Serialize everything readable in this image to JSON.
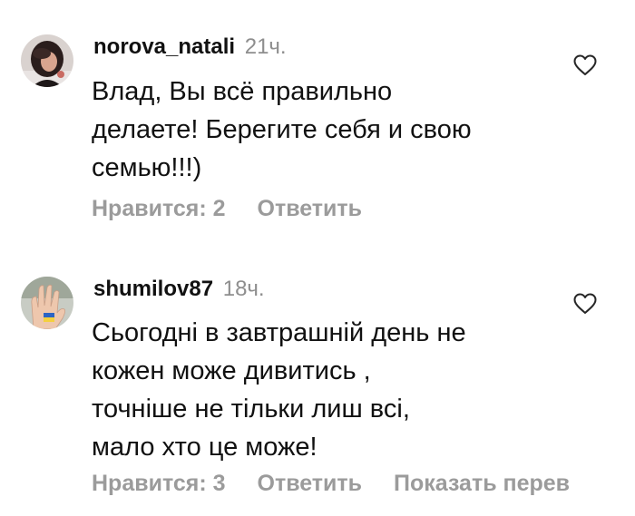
{
  "comments": [
    {
      "username": "norova_natali",
      "time": "21ч.",
      "text": "Влад, Вы всё правильно\nделаете! Берегите себя и свою\nсемью!!!)",
      "likes_label": "Нравится: 2",
      "reply_label": "Ответить",
      "avatar_icon": "profile-photo-woman",
      "like_icon": "heart-outline-icon"
    },
    {
      "username": "shumilov87",
      "time": "18ч.",
      "text": "Сьогодні в завтрашній день не\nкожен може дивитись ,\nточніше не тільки лиш всі,\nмало хто це може!",
      "likes_label": "Нравится: 3",
      "reply_label": "Ответить",
      "translate_label": "Показать перев",
      "avatar_icon": "profile-photo-hand-flag",
      "like_icon": "heart-outline-icon"
    }
  ],
  "colors": {
    "text": "#111111",
    "muted": "#8e8e8e",
    "action": "#9b9b9b"
  }
}
